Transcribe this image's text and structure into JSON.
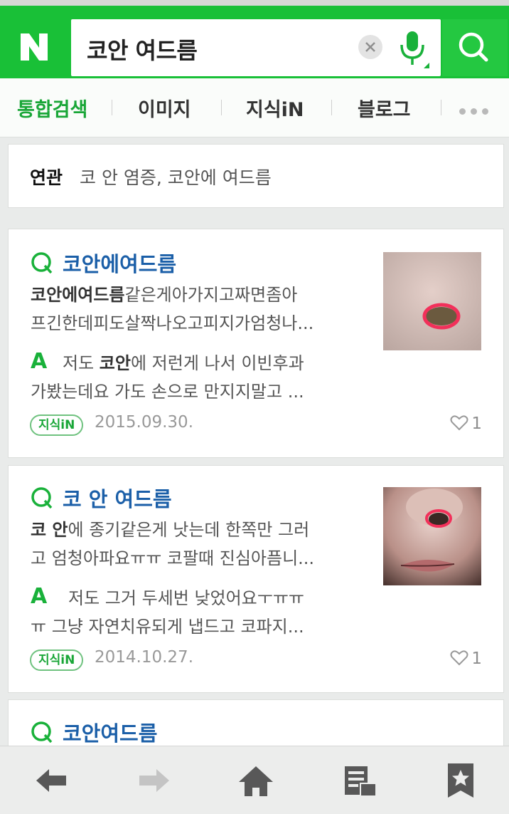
{
  "search": {
    "query": "코안 여드름"
  },
  "tabs": [
    {
      "label": "통합검색",
      "active": true
    },
    {
      "label": "이미지",
      "active": false
    },
    {
      "label": "지식iN",
      "active": false
    },
    {
      "label": "블로그",
      "active": false
    }
  ],
  "related": {
    "label": "연관",
    "text": "코 안 염증, 코안에 여드름"
  },
  "results": [
    {
      "title": "코안에여드름",
      "question_bold": "코안에여드름",
      "question_line1_rest": "같은게아가지고짜면좀아",
      "question_line2": "프긴한데피도살짝나오고피지가엄청나...",
      "answer_bold": "코안",
      "answer_line1_pre": "저도 ",
      "answer_line1_post": "에 저런게 나서 이빈후과",
      "answer_line2": "가봤는데요 가도 손으로 만지지말고 ...",
      "badge": "지식iN",
      "date": "2015.09.30.",
      "likes": "1"
    },
    {
      "title": "코 안 여드름",
      "question_bold": "코 안",
      "question_line1_rest": "에 종기같은게 낫는데 한쪽만 그러",
      "question_line2": "고 엄청아파요ㅠㅠ 코팔때 진심아픔니...",
      "answer_line1": "저도 그거 두세번 낮었어요ㅜㅠㅠ",
      "answer_line2": "ㅠ 그냥 자연치유되게 냅드고 코파지...",
      "badge": "지식iN",
      "date": "2014.10.27.",
      "likes": "1"
    },
    {
      "title": "코안여드름"
    }
  ],
  "colors": {
    "brand_green": "#19c037",
    "title_blue": "#1b5fa8",
    "active_tab": "#19a637"
  }
}
